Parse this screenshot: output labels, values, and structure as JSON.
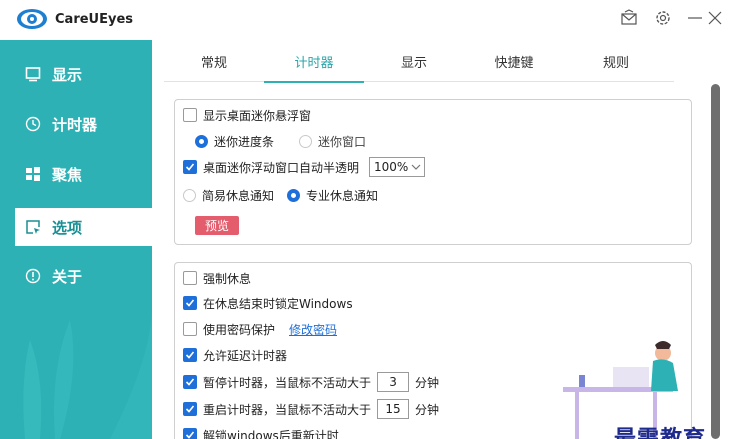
{
  "app": {
    "title": "CareUEyes"
  },
  "sidebar": {
    "items": [
      {
        "label": "显示",
        "icon": "monitor-icon"
      },
      {
        "label": "计时器",
        "icon": "clock-icon"
      },
      {
        "label": "聚焦",
        "icon": "grid-icon"
      },
      {
        "label": "选项",
        "icon": "cursor-window-icon",
        "active": true
      },
      {
        "label": "关于",
        "icon": "info-icon"
      }
    ]
  },
  "tabs": [
    {
      "label": "常规"
    },
    {
      "label": "计时器",
      "active": true
    },
    {
      "label": "显示"
    },
    {
      "label": "快捷键"
    },
    {
      "label": "规则"
    }
  ],
  "panel1": {
    "mini_window_label": "显示桌面迷你悬浮窗",
    "mini_window_checked": false,
    "mini_progress_label": "迷你进度条",
    "mini_window_option_label": "迷你窗口",
    "semi_transparent_label": "桌面迷你浮动窗口自动半透明",
    "semi_transparent_checked": true,
    "opacity_value": "100%",
    "simple_notify_label": "简易休息通知",
    "pro_notify_label": "专业休息通知",
    "preview_label": "预览"
  },
  "panel2": {
    "force_rest_label": "强制休息",
    "force_rest_checked": false,
    "lock_windows_label": "在休息结束时锁定Windows",
    "lock_windows_checked": true,
    "password_label": "使用密码保护",
    "password_checked": false,
    "change_password_label": "修改密码",
    "allow_delay_label": "允许延迟计时器",
    "allow_delay_checked": true,
    "pause_label": "暂停计时器，当鼠标不活动大于",
    "pause_value": "3",
    "pause_unit": "分钟",
    "restart_label": "重启计时器，当鼠标不活动大于",
    "restart_value": "15",
    "restart_unit": "分钟",
    "unlock_restart_label": "解锁windows后重新计时"
  },
  "watermark": "最需教育",
  "colors": {
    "accent": "#2db1b4",
    "checkbox": "#1e6fd9",
    "preview": "#e35d6d"
  }
}
